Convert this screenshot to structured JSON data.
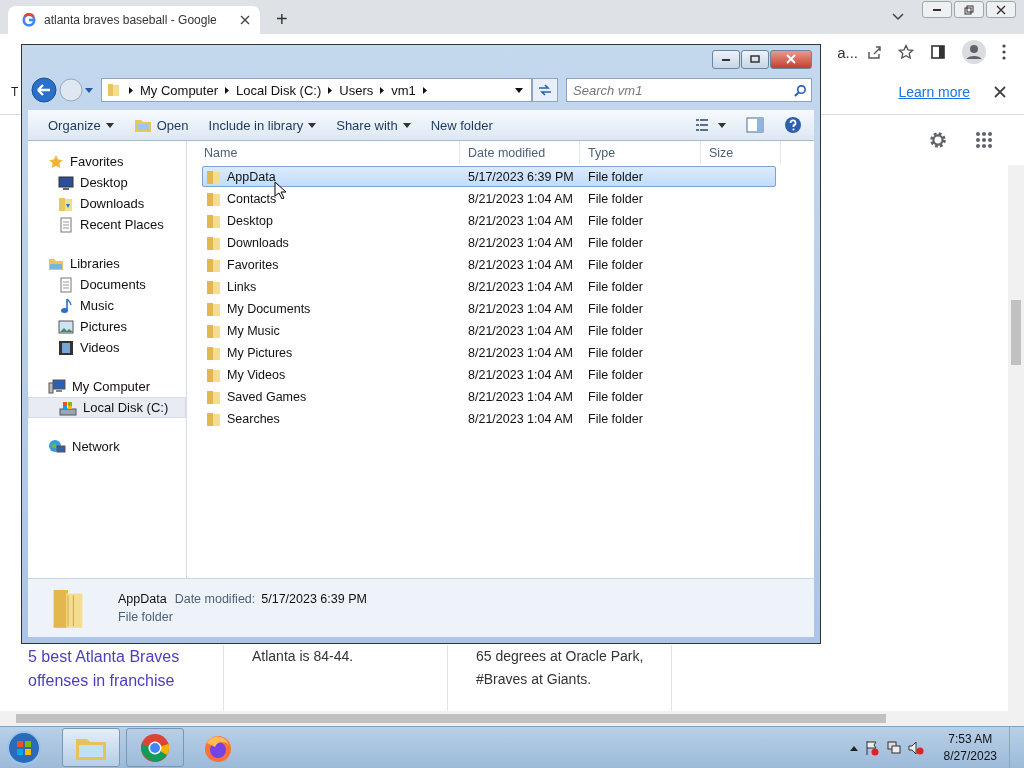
{
  "browser": {
    "tab_title": "atlanta braves baseball - Google",
    "new_tab": "+",
    "address_fragment": "a...",
    "infobar": {
      "text_fragment": "T",
      "link": "Learn more"
    },
    "results": [
      {
        "kind": "link",
        "text": "5 best Atlanta Braves offenses in franchise"
      },
      {
        "kind": "text",
        "text": "Atlanta is 84-44."
      },
      {
        "kind": "text",
        "text": "65 degrees at Oracle Park, #Braves at Giants."
      }
    ]
  },
  "explorer": {
    "breadcrumb": [
      "My Computer",
      "Local Disk (C:)",
      "Users",
      "vm1"
    ],
    "search": {
      "placeholder": "Search vm1"
    },
    "toolbar": [
      {
        "label": "Organize",
        "menu": true
      },
      {
        "label": "Open",
        "menu": false
      },
      {
        "label": "Include in library",
        "menu": true
      },
      {
        "label": "Share with",
        "menu": true
      },
      {
        "label": "New folder",
        "menu": false
      }
    ],
    "sidebar": [
      {
        "label": "Favorites",
        "children": [
          {
            "label": "Desktop",
            "selected": false
          },
          {
            "label": "Downloads",
            "selected": false
          },
          {
            "label": "Recent Places",
            "selected": false
          }
        ]
      },
      {
        "label": "Libraries",
        "children": [
          {
            "label": "Documents",
            "selected": false
          },
          {
            "label": "Music",
            "selected": false
          },
          {
            "label": "Pictures",
            "selected": false
          },
          {
            "label": "Videos",
            "selected": false
          }
        ]
      },
      {
        "label": "My Computer",
        "children": [
          {
            "label": "Local Disk (C:)",
            "selected": true
          }
        ]
      },
      {
        "label": "Network"
      }
    ],
    "columns": [
      "Name",
      "Date modified",
      "Type",
      "Size"
    ],
    "files": [
      {
        "name": "AppData",
        "date": "5/17/2023 6:39 PM",
        "type": "File folder",
        "selected": true
      },
      {
        "name": "Contacts",
        "date": "8/21/2023 1:04 AM",
        "type": "File folder",
        "selected": false
      },
      {
        "name": "Desktop",
        "date": "8/21/2023 1:04 AM",
        "type": "File folder",
        "selected": false
      },
      {
        "name": "Downloads",
        "date": "8/21/2023 1:04 AM",
        "type": "File folder",
        "selected": false
      },
      {
        "name": "Favorites",
        "date": "8/21/2023 1:04 AM",
        "type": "File folder",
        "selected": false
      },
      {
        "name": "Links",
        "date": "8/21/2023 1:04 AM",
        "type": "File folder",
        "selected": false
      },
      {
        "name": "My Documents",
        "date": "8/21/2023 1:04 AM",
        "type": "File folder",
        "selected": false
      },
      {
        "name": "My Music",
        "date": "8/21/2023 1:04 AM",
        "type": "File folder",
        "selected": false
      },
      {
        "name": "My Pictures",
        "date": "8/21/2023 1:04 AM",
        "type": "File folder",
        "selected": false
      },
      {
        "name": "My Videos",
        "date": "8/21/2023 1:04 AM",
        "type": "File folder",
        "selected": false
      },
      {
        "name": "Saved Games",
        "date": "8/21/2023 1:04 AM",
        "type": "File folder",
        "selected": false
      },
      {
        "name": "Searches",
        "date": "8/21/2023 1:04 AM",
        "type": "File folder",
        "selected": false
      }
    ],
    "details": {
      "name": "AppData",
      "date_label": "Date modified:",
      "date": "5/17/2023 6:39 PM",
      "type": "File folder"
    }
  },
  "taskbar": {
    "time": "7:53 AM",
    "date": "8/27/2023"
  }
}
